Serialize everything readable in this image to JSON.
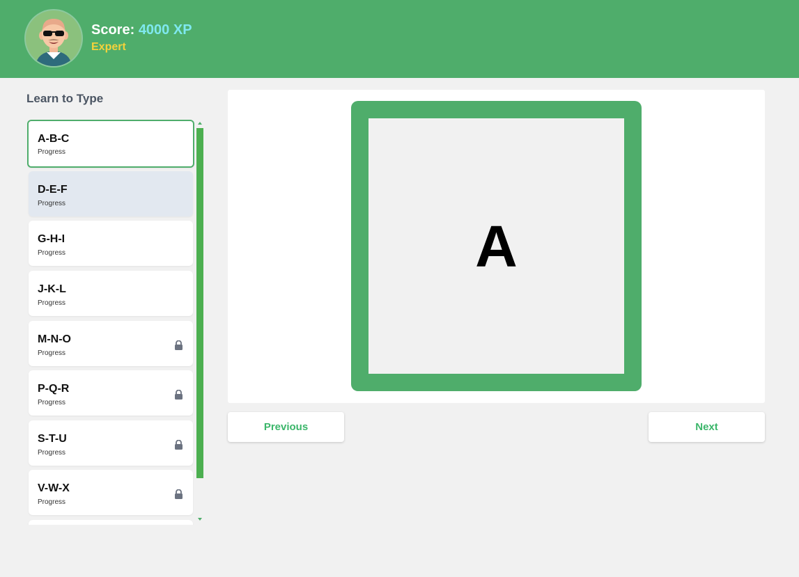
{
  "header": {
    "score_label": "Score:",
    "score_value": "4000 XP",
    "rank": "Expert",
    "avatar_icon": "bald-man-sunglasses-avatar"
  },
  "sidebar": {
    "title": "Learn to Type",
    "lessons": [
      {
        "name": "A-B-C",
        "progress": "Progress",
        "locked": false,
        "state": "active"
      },
      {
        "name": "D-E-F",
        "progress": "Progress",
        "locked": false,
        "state": "hover"
      },
      {
        "name": "G-H-I",
        "progress": "Progress",
        "locked": false,
        "state": "normal"
      },
      {
        "name": "J-K-L",
        "progress": "Progress",
        "locked": false,
        "state": "normal"
      },
      {
        "name": "M-N-O",
        "progress": "Progress",
        "locked": true,
        "state": "normal"
      },
      {
        "name": "P-Q-R",
        "progress": "Progress",
        "locked": true,
        "state": "normal"
      },
      {
        "name": "S-T-U",
        "progress": "Progress",
        "locked": true,
        "state": "normal"
      },
      {
        "name": "V-W-X",
        "progress": "Progress",
        "locked": true,
        "state": "normal"
      }
    ]
  },
  "main": {
    "current_letter": "A",
    "previous_label": "Previous",
    "next_label": "Next"
  },
  "colors": {
    "brand_green": "#4fad6b",
    "score_cyan": "#7fe8ef",
    "rank_yellow": "#f4d23b",
    "button_text": "#3bb66a",
    "lock_gray": "#6b7280"
  }
}
